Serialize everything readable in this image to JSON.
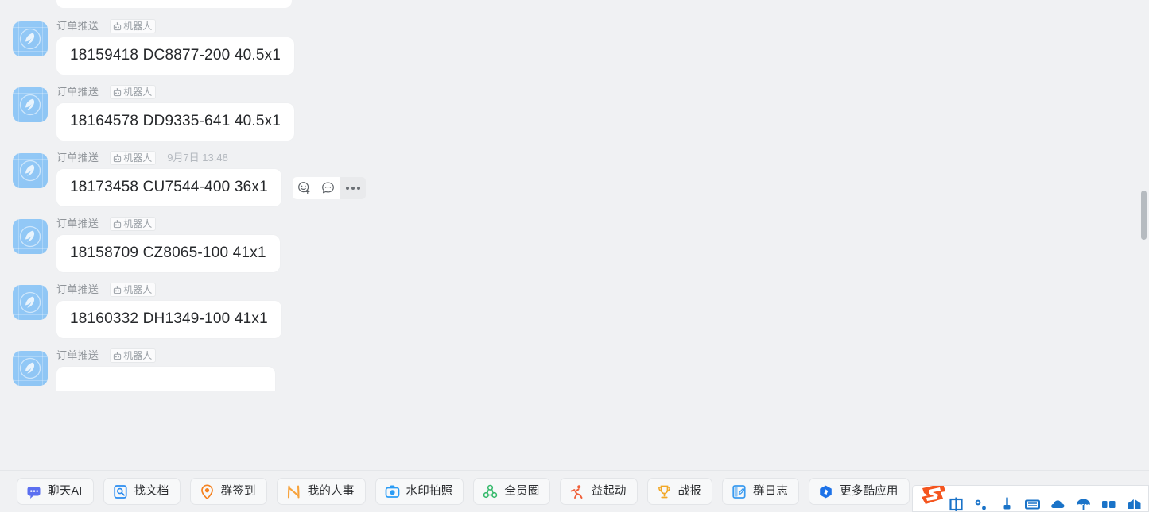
{
  "chat": {
    "sender_name": "订单推送",
    "bot_badge_label": "机器人",
    "messages": [
      {
        "id": "m0",
        "text": "",
        "time": "",
        "partial": "top"
      },
      {
        "id": "m1",
        "text": "18159418 DC8877-200 40.5x1",
        "time": ""
      },
      {
        "id": "m2",
        "text": "18164578 DD9335-641 40.5x1",
        "time": ""
      },
      {
        "id": "m3",
        "text": "18173458 CU7544-400 36x1",
        "time": "9月7日 13:48",
        "hovered": true
      },
      {
        "id": "m4",
        "text": "18158709 CZ8065-100 41x1",
        "time": ""
      },
      {
        "id": "m5",
        "text": "18160332 DH1349-100 41x1",
        "time": ""
      },
      {
        "id": "m6",
        "text": "",
        "time": "",
        "partial": "bottom"
      }
    ],
    "hover_actions": [
      {
        "name": "add-reaction",
        "label": "添加表情回应"
      },
      {
        "name": "reply",
        "label": "回复"
      },
      {
        "name": "more",
        "label": "更多"
      }
    ]
  },
  "toolbar": {
    "buttons": [
      {
        "label": "聊天AI",
        "icon": "chat-ai-icon",
        "color": "#5b6ff0"
      },
      {
        "label": "找文档",
        "icon": "find-doc-icon",
        "color": "#2b8cf0"
      },
      {
        "label": "群签到",
        "icon": "group-checkin-icon",
        "color": "#f58220"
      },
      {
        "label": "我的人事",
        "icon": "my-hr-icon",
        "color": "#f7a23b"
      },
      {
        "label": "水印拍照",
        "icon": "watermark-camera-icon",
        "color": "#2b9cf5"
      },
      {
        "label": "全员圈",
        "icon": "all-staff-circle-icon",
        "color": "#35b96b"
      },
      {
        "label": "益起动",
        "icon": "yiqidong-run-icon",
        "color": "#f0603a"
      },
      {
        "label": "战报",
        "icon": "trophy-icon",
        "color": "#f2a827"
      },
      {
        "label": "群日志",
        "icon": "group-log-icon",
        "color": "#3a9bf0"
      },
      {
        "label": "更多酷应用",
        "icon": "more-apps-icon",
        "color": "#1d72e8"
      }
    ]
  },
  "ime": {
    "logo": "sogou-logo",
    "icons": [
      "chinese-mode-icon",
      "punctuation-icon",
      "pen-icon",
      "keyboard-icon",
      "cloud-icon",
      "umbrella-icon",
      "skin-icon",
      "toolbox-icon"
    ]
  },
  "colors": {
    "background": "#f0f1f3",
    "bubble": "#ffffff",
    "avatar": "#8fc7f5",
    "scrollbar_thumb": "#b6bbc0"
  }
}
